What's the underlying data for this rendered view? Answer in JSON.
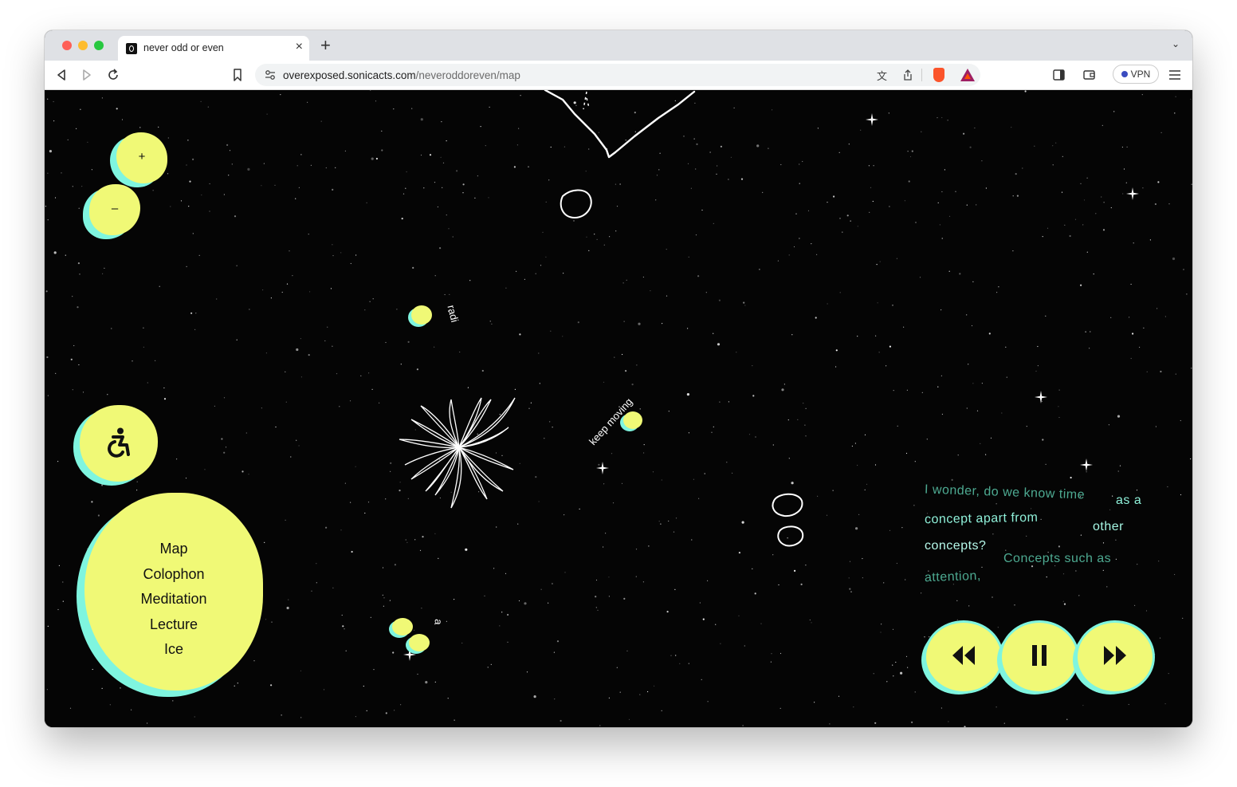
{
  "browser": {
    "tab_title": "never odd or even",
    "url_host": "overexposed.sonicacts.com",
    "url_path": "/neveroddoreven/map",
    "vpn_label": "VPN"
  },
  "map_controls": {
    "zoom_in_label": "+",
    "zoom_out_label": "–"
  },
  "nav": {
    "items": [
      "Map",
      "Colophon",
      "Meditation",
      "Lecture",
      "Ice"
    ]
  },
  "floating_words": {
    "radi": "radi",
    "keep_moving": "keep moving",
    "a": "a"
  },
  "caption": {
    "line1a": "I wonder, do we know time",
    "line1b": "as a",
    "line2a": "concept apart from",
    "line2b": "other",
    "line3a": "concepts?",
    "line3b": "Concepts such as",
    "line4a": "attention,"
  },
  "colors": {
    "accent_yellow": "#f0f976",
    "accent_cyan": "#7ff5df",
    "caption_teal": "#5fd3b4",
    "background": "#050505"
  },
  "icons": [
    "accessibility-icon",
    "rewind-icon",
    "pause-icon",
    "fast-forward-icon"
  ]
}
